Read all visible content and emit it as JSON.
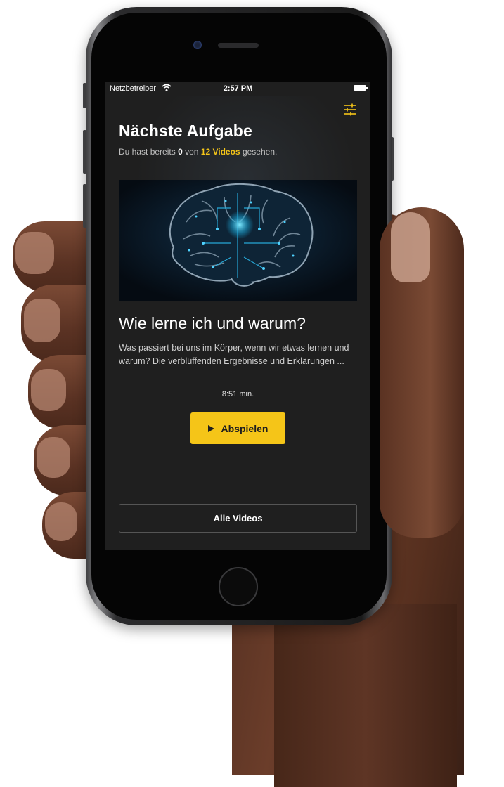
{
  "status_bar": {
    "carrier": "Netzbetreiber",
    "time": "2:57 PM",
    "icons": [
      "wifi-icon",
      "battery-icon"
    ]
  },
  "header": {
    "settings_icon": "sliders-icon",
    "title": "Nächste Aufgabe",
    "progress": {
      "prefix": "Du hast bereits",
      "watched_count": "0",
      "of": "von",
      "total": "12 Videos",
      "suffix": "gesehen."
    }
  },
  "next_video": {
    "thumbnail": "circuit-brain-image",
    "title": "Wie lerne ich und warum?",
    "description": "Was passiert bei uns im Körper, wenn wir etwas lernen und warum? Die verblüffenden Ergebnisse und Erklärungen ...",
    "duration": "8:51 min.",
    "play_label": "Abspielen"
  },
  "footer": {
    "all_videos_label": "Alle Videos"
  },
  "colors": {
    "accent": "#f5c518",
    "background": "#1f1f1f",
    "text": "#ffffff"
  }
}
